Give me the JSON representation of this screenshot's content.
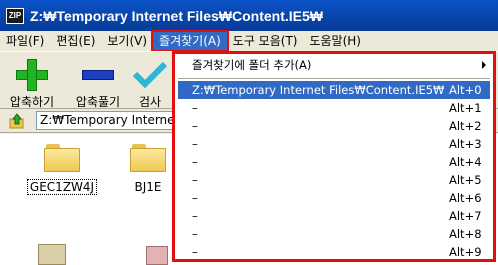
{
  "window": {
    "title": "Z:₩Temporary Internet Files₩Content.IE5₩"
  },
  "menubar": {
    "items": [
      "파일(F)",
      "편집(E)",
      "보기(V)",
      "즐겨찾기(A)",
      "도구 모음(T)",
      "도움말(H)"
    ]
  },
  "toolbar": {
    "compress_label": "압축하기",
    "decompress_label": "압축풀기",
    "check_label": "검사"
  },
  "address": {
    "value": "Z:₩Temporary Internet Files₩Content.IE5₩"
  },
  "files": [
    {
      "name": "GEC1ZW4J"
    },
    {
      "name": "BJ1E"
    }
  ],
  "favorites_menu": {
    "add_folder": "즐겨찾기에 폴더 추가(A)",
    "entries": [
      {
        "label": "Z:₩Temporary Internet Files₩Content.IE5₩",
        "accel": "Alt+0"
      },
      {
        "label": "–",
        "accel": "Alt+1"
      },
      {
        "label": "–",
        "accel": "Alt+2"
      },
      {
        "label": "–",
        "accel": "Alt+3"
      },
      {
        "label": "–",
        "accel": "Alt+4"
      },
      {
        "label": "–",
        "accel": "Alt+5"
      },
      {
        "label": "–",
        "accel": "Alt+6"
      },
      {
        "label": "–",
        "accel": "Alt+7"
      },
      {
        "label": "–",
        "accel": "Alt+8"
      },
      {
        "label": "–",
        "accel": "Alt+9"
      }
    ]
  },
  "colors": {
    "titlebar": "#0844a8",
    "highlight": "#316ac5",
    "annotation_border": "#e01010"
  }
}
